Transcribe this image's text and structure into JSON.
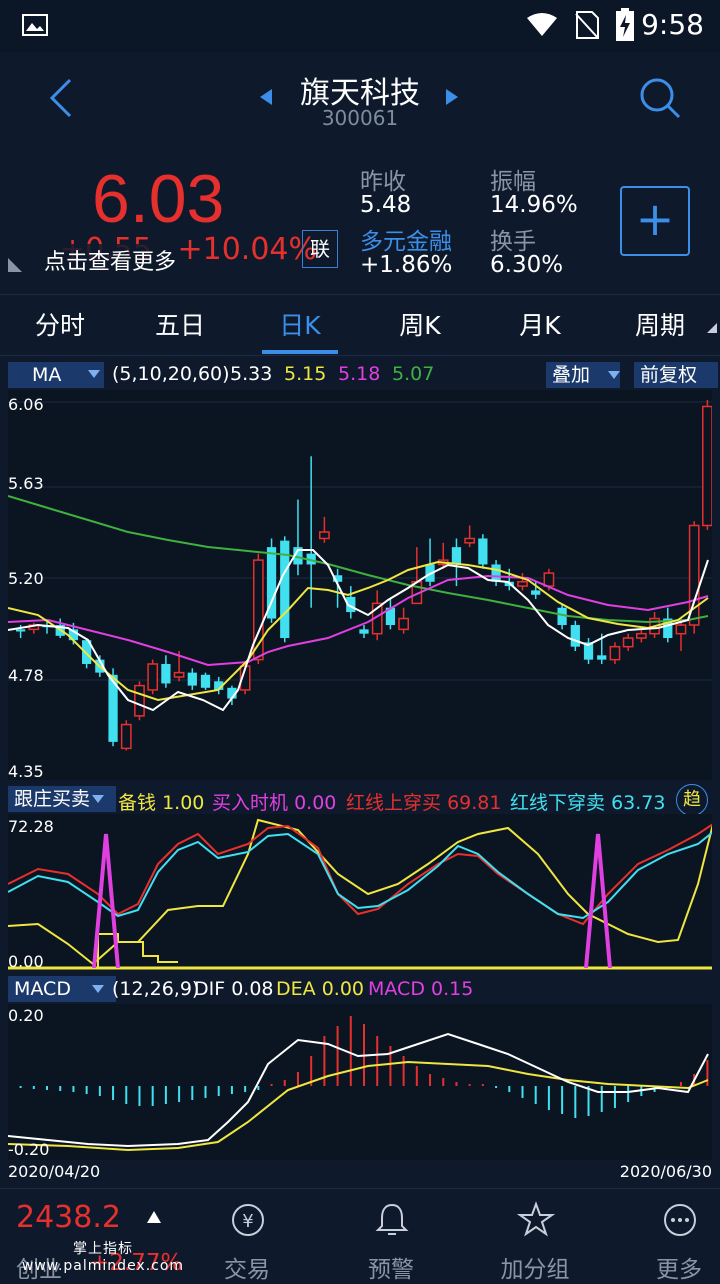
{
  "status": {
    "time": "9:58"
  },
  "header": {
    "title": "旗天科技",
    "code": "300061"
  },
  "quote": {
    "price": "6.03",
    "change": "+0.55",
    "change_pct": "+10.04%",
    "hint": "点击查看更多",
    "link_label": "联",
    "stats": [
      {
        "label": "昨收",
        "value": "5.48"
      },
      {
        "label": "振幅",
        "value": "14.96%"
      },
      {
        "label": "多元金融",
        "value": "+1.86%"
      },
      {
        "label": "换手",
        "value": "6.30%"
      }
    ],
    "add_label": "+"
  },
  "tabs": [
    "分时",
    "五日",
    "日K",
    "周K",
    "月K",
    "周期"
  ],
  "active_tab": "日K",
  "ma_legend": {
    "name": "MA",
    "params": "(5,10,20,60)",
    "values": [
      {
        "v": "5.33",
        "color": "#ffffff"
      },
      {
        "v": "5.15",
        "color": "#f0e640"
      },
      {
        "v": "5.18",
        "color": "#e040e0"
      },
      {
        "v": "5.07",
        "color": "#40b040"
      }
    ],
    "overlay": "叠加",
    "adjust": "前复权"
  },
  "price_axis": [
    "6.06",
    "5.63",
    "5.20",
    "4.78",
    "4.35"
  ],
  "indicator1": {
    "name": "跟庄买卖",
    "items": [
      {
        "label": "备钱",
        "value": "1.00",
        "color": "#f0e640"
      },
      {
        "label": "买入时机",
        "value": "0.00",
        "color": "#e040e0"
      },
      {
        "label": "红线上穿买",
        "value": "69.81",
        "color": "#e6302d"
      },
      {
        "label": "红线下穿卖",
        "value": "63.73",
        "color": "#40e0f0"
      }
    ],
    "trend_label": "趋",
    "axis": [
      "72.28",
      "0.00"
    ]
  },
  "indicator2": {
    "name": "MACD",
    "params": "(12,26,9)",
    "items": [
      {
        "label": "DIF",
        "value": "0.08",
        "color": "#ffffff"
      },
      {
        "label": "DEA",
        "value": "0.00",
        "color": "#f0e640"
      },
      {
        "label": "MACD",
        "value": "0.15",
        "color": "#e040e0"
      }
    ],
    "axis": [
      "0.20",
      "-0.20"
    ]
  },
  "date_range": {
    "start": "2020/04/20",
    "end": "2020/06/30"
  },
  "bottom_nav": {
    "index_value": "2438.2",
    "index_change": "+2.77%",
    "index_name": "创业",
    "watermark": "掌上指标 www.palmindex.com",
    "items": [
      {
        "label": "交易",
        "icon": "trade-icon"
      },
      {
        "label": "预警",
        "icon": "bell-icon"
      },
      {
        "label": "加分组",
        "icon": "star-icon"
      },
      {
        "label": "更多",
        "icon": "more-icon"
      }
    ]
  },
  "chart_data": {
    "type": "candlestick",
    "ylim": [
      4.35,
      6.06
    ],
    "candles": [
      [
        5.0,
        4.99,
        5.02,
        4.96
      ],
      [
        5.0,
        5.02,
        5.03,
        4.98
      ],
      [
        5.02,
        5.01,
        5.04,
        4.98
      ],
      [
        5.02,
        4.97,
        5.05,
        4.96
      ],
      [
        5.0,
        4.95,
        5.03,
        4.93
      ],
      [
        4.95,
        4.84,
        4.96,
        4.82
      ],
      [
        4.86,
        4.8,
        4.88,
        4.78
      ],
      [
        4.79,
        4.48,
        4.82,
        4.46
      ],
      [
        4.45,
        4.56,
        4.58,
        4.44
      ],
      [
        4.6,
        4.74,
        4.76,
        4.58
      ],
      [
        4.72,
        4.84,
        4.86,
        4.7
      ],
      [
        4.84,
        4.75,
        4.88,
        4.73
      ],
      [
        4.78,
        4.8,
        4.9,
        4.76
      ],
      [
        4.8,
        4.74,
        4.82,
        4.72
      ],
      [
        4.79,
        4.73,
        4.8,
        4.72
      ],
      [
        4.76,
        4.72,
        4.78,
        4.7
      ],
      [
        4.73,
        4.68,
        4.74,
        4.65
      ],
      [
        4.72,
        4.83,
        4.85,
        4.7
      ],
      [
        4.86,
        5.32,
        5.35,
        4.84
      ],
      [
        5.38,
        5.05,
        5.42,
        5.03
      ],
      [
        5.41,
        4.96,
        5.43,
        4.94
      ],
      [
        5.38,
        5.3,
        5.6,
        5.25
      ],
      [
        5.35,
        5.3,
        5.8,
        5.1
      ],
      [
        5.42,
        5.45,
        5.52,
        5.4
      ],
      [
        5.25,
        5.22,
        5.28,
        5.1
      ],
      [
        5.15,
        5.08,
        5.2,
        5.05
      ],
      [
        5.0,
        4.98,
        5.02,
        4.96
      ],
      [
        4.98,
        5.12,
        5.18,
        4.95
      ],
      [
        5.1,
        5.02,
        5.14,
        5.0
      ],
      [
        5.0,
        5.05,
        5.1,
        4.98
      ],
      [
        5.12,
        5.22,
        5.38,
        5.12
      ],
      [
        5.3,
        5.22,
        5.42,
        5.2
      ],
      [
        5.3,
        5.32,
        5.4,
        5.28
      ],
      [
        5.38,
        5.3,
        5.42,
        5.2
      ],
      [
        5.4,
        5.42,
        5.48,
        5.38
      ],
      [
        5.42,
        5.3,
        5.44,
        5.28
      ],
      [
        5.3,
        5.22,
        5.32,
        5.2
      ],
      [
        5.22,
        5.2,
        5.28,
        5.18
      ],
      [
        5.2,
        5.22,
        5.26,
        5.18
      ],
      [
        5.18,
        5.16,
        5.22,
        5.14
      ],
      [
        5.2,
        5.26,
        5.28,
        5.18
      ],
      [
        5.1,
        5.02,
        5.12,
        5.0
      ],
      [
        5.02,
        4.92,
        5.04,
        4.9
      ],
      [
        4.94,
        4.86,
        4.96,
        4.84
      ],
      [
        4.88,
        4.86,
        4.98,
        4.84
      ],
      [
        4.86,
        4.92,
        4.94,
        4.84
      ],
      [
        4.92,
        4.96,
        4.98,
        4.9
      ],
      [
        4.96,
        4.98,
        5.0,
        4.94
      ],
      [
        4.98,
        5.05,
        5.08,
        4.96
      ],
      [
        5.05,
        4.96,
        5.1,
        4.94
      ],
      [
        4.98,
        5.02,
        5.05,
        4.9
      ],
      [
        5.02,
        5.48,
        5.5,
        4.98
      ],
      [
        5.48,
        6.03,
        6.06,
        5.46
      ]
    ]
  }
}
